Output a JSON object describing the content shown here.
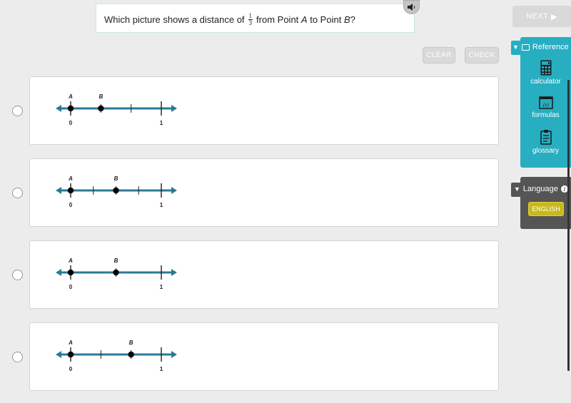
{
  "question": {
    "prefix": "Which picture shows a distance of",
    "fraction_numerator": "1",
    "fraction_denominator": "3",
    "middle1": "from Point",
    "point_a": "A",
    "middle2": "to Point",
    "point_b": "B",
    "suffix": "?"
  },
  "audio_button": {
    "icon": "speaker-icon"
  },
  "toolbar": {
    "next_label": "NEXT",
    "next_icon": "▶",
    "clear_label": "CLEAR",
    "check_label": "CHECK"
  },
  "reference": {
    "title": "Reference",
    "toggle_icon": "▼",
    "items": [
      {
        "label": "calculator",
        "icon": "calculator-icon"
      },
      {
        "label": "formulas",
        "icon": "formulas-icon",
        "glyph": "(x)"
      },
      {
        "label": "glossary",
        "icon": "clipboard-icon"
      }
    ]
  },
  "language": {
    "title": "Language",
    "toggle_icon": "▼",
    "info_glyph": "i",
    "selected": "ENGLISH"
  },
  "colors": {
    "reference_panel": "#27aec1",
    "language_panel": "#555555",
    "language_button": "#c8b91a",
    "number_line": "#2b7a96"
  },
  "options": [
    {
      "label_a": "A",
      "label_b": "B",
      "label_zero": "0",
      "label_one": "1",
      "divisions": 3,
      "point_b_value": 0.3333,
      "selected": false
    },
    {
      "label_a": "A",
      "label_b": "B",
      "label_zero": "0",
      "label_one": "1",
      "divisions": 4,
      "point_b_value": 0.5,
      "selected": false
    },
    {
      "label_a": "A",
      "label_b": "B",
      "label_zero": "0",
      "label_one": "1",
      "divisions": 2,
      "point_b_value": 0.5,
      "selected": false
    },
    {
      "label_a": "A",
      "label_b": "B",
      "label_zero": "0",
      "label_one": "1",
      "divisions": 3,
      "point_b_value": 0.6667,
      "selected": false
    }
  ]
}
